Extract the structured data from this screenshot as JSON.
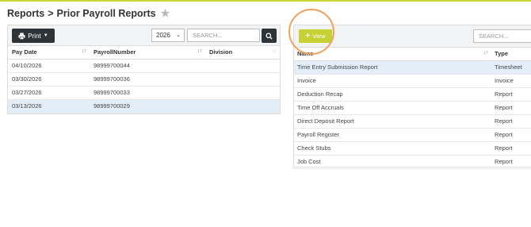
{
  "breadcrumb": {
    "parent": "Reports",
    "separator": ">",
    "current": "Prior Payroll Reports"
  },
  "left_toolbar": {
    "print_label": "Print",
    "year_value": "2026",
    "search_placeholder": "SEARCH..."
  },
  "payroll_table": {
    "columns": [
      "Pay Date",
      "PayrollNumber",
      "Division"
    ],
    "rows": [
      {
        "pay_date": "04/10/2026",
        "payroll_number": "98999700044",
        "division": ""
      },
      {
        "pay_date": "03/30/2026",
        "payroll_number": "98999700036",
        "division": ""
      },
      {
        "pay_date": "03/27/2026",
        "payroll_number": "98999700033",
        "division": ""
      },
      {
        "pay_date": "03/13/2026",
        "payroll_number": "98999700029",
        "division": ""
      }
    ],
    "selected_index": 3
  },
  "right_toolbar": {
    "view_label": "View",
    "search_placeholder": "SEARCH..."
  },
  "reports_table": {
    "columns": [
      "Name",
      "Type"
    ],
    "rows": [
      {
        "name": "Time Entry Submission Report",
        "type": "Timesheet"
      },
      {
        "name": "Invoice",
        "type": "Invoice"
      },
      {
        "name": "Deduction Recap",
        "type": "Report"
      },
      {
        "name": "Time Off Accruals",
        "type": "Report"
      },
      {
        "name": "Direct Deposit Report",
        "type": "Report"
      },
      {
        "name": "Payroll Register",
        "type": "Report"
      },
      {
        "name": "Check Stubs",
        "type": "Report"
      },
      {
        "name": "Job Cost",
        "type": "Report"
      }
    ],
    "selected_index": 0
  },
  "colors": {
    "accent": "#c5d135",
    "dark_button": "#2e3338",
    "selected_row": "#e4eef9",
    "highlight_ring": "#f0a25a"
  }
}
